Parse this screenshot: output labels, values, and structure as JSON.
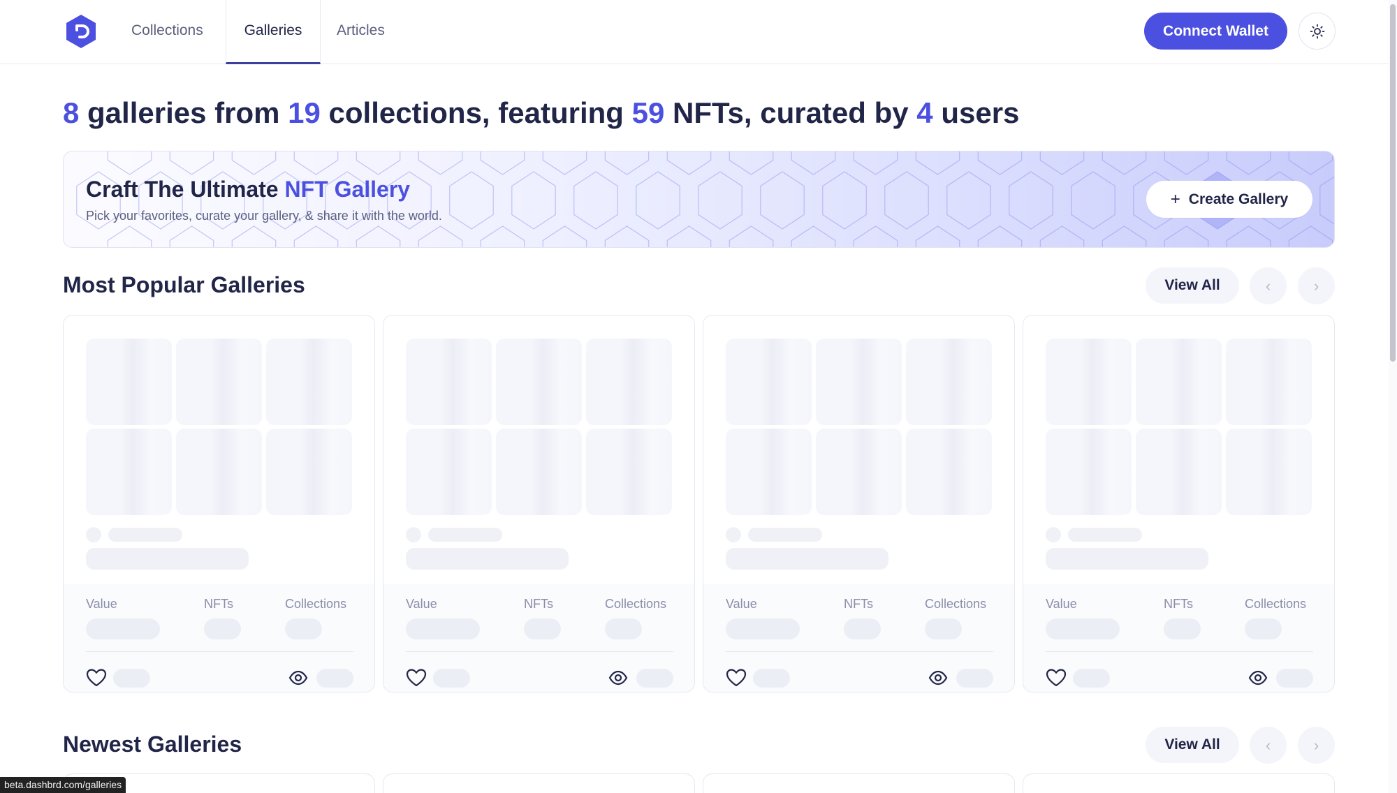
{
  "header": {
    "nav": [
      {
        "label": "Collections"
      },
      {
        "label": "Galleries",
        "active": true
      },
      {
        "label": "Articles"
      }
    ],
    "connect_label": "Connect Wallet",
    "theme_icon": "sun-icon"
  },
  "headline": {
    "galleries": "8",
    "t1": " galleries from ",
    "collections": "19",
    "t2": " collections, featuring ",
    "nfts": "59",
    "t3": " NFTs, curated by ",
    "users": "4",
    "t4": " users"
  },
  "banner": {
    "title_prefix": "Craft The Ultimate ",
    "title_accent": "NFT Gallery",
    "subtitle": "Pick your favorites, curate your gallery, & share it with the world.",
    "create_label": "Create Gallery"
  },
  "sections": {
    "popular": {
      "title": "Most Popular Galleries",
      "view_all": "View All"
    },
    "newest": {
      "title": "Newest Galleries",
      "view_all": "View All"
    }
  },
  "card_stats": {
    "value": "Value",
    "nfts": "NFTs",
    "collections": "Collections"
  },
  "status_bar": {
    "url": "beta.dashbrd.com/galleries"
  },
  "colors": {
    "accent": "#4b50e0",
    "text": "#212548",
    "muted": "#8a8ea8"
  }
}
